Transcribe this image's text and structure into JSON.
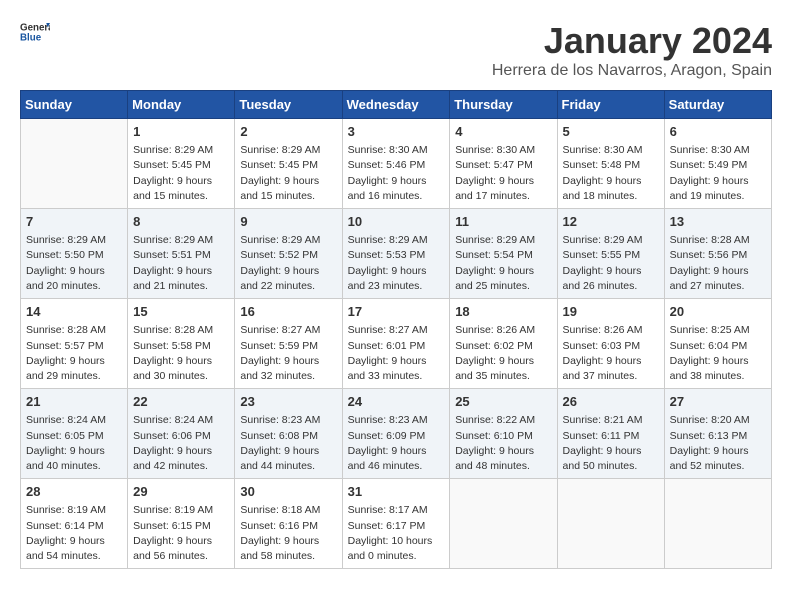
{
  "logo": {
    "general": "General",
    "blue": "Blue"
  },
  "title": "January 2024",
  "subtitle": "Herrera de los Navarros, Aragon, Spain",
  "weekdays": [
    "Sunday",
    "Monday",
    "Tuesday",
    "Wednesday",
    "Thursday",
    "Friday",
    "Saturday"
  ],
  "weeks": [
    [
      {
        "day": "",
        "info": ""
      },
      {
        "day": "1",
        "info": "Sunrise: 8:29 AM\nSunset: 5:45 PM\nDaylight: 9 hours\nand 15 minutes."
      },
      {
        "day": "2",
        "info": "Sunrise: 8:29 AM\nSunset: 5:45 PM\nDaylight: 9 hours\nand 15 minutes."
      },
      {
        "day": "3",
        "info": "Sunrise: 8:30 AM\nSunset: 5:46 PM\nDaylight: 9 hours\nand 16 minutes."
      },
      {
        "day": "4",
        "info": "Sunrise: 8:30 AM\nSunset: 5:47 PM\nDaylight: 9 hours\nand 17 minutes."
      },
      {
        "day": "5",
        "info": "Sunrise: 8:30 AM\nSunset: 5:48 PM\nDaylight: 9 hours\nand 18 minutes."
      },
      {
        "day": "6",
        "info": "Sunrise: 8:30 AM\nSunset: 5:49 PM\nDaylight: 9 hours\nand 19 minutes."
      }
    ],
    [
      {
        "day": "7",
        "info": "Sunrise: 8:29 AM\nSunset: 5:50 PM\nDaylight: 9 hours\nand 20 minutes."
      },
      {
        "day": "8",
        "info": "Sunrise: 8:29 AM\nSunset: 5:51 PM\nDaylight: 9 hours\nand 21 minutes."
      },
      {
        "day": "9",
        "info": "Sunrise: 8:29 AM\nSunset: 5:52 PM\nDaylight: 9 hours\nand 22 minutes."
      },
      {
        "day": "10",
        "info": "Sunrise: 8:29 AM\nSunset: 5:53 PM\nDaylight: 9 hours\nand 23 minutes."
      },
      {
        "day": "11",
        "info": "Sunrise: 8:29 AM\nSunset: 5:54 PM\nDaylight: 9 hours\nand 25 minutes."
      },
      {
        "day": "12",
        "info": "Sunrise: 8:29 AM\nSunset: 5:55 PM\nDaylight: 9 hours\nand 26 minutes."
      },
      {
        "day": "13",
        "info": "Sunrise: 8:28 AM\nSunset: 5:56 PM\nDaylight: 9 hours\nand 27 minutes."
      }
    ],
    [
      {
        "day": "14",
        "info": "Sunrise: 8:28 AM\nSunset: 5:57 PM\nDaylight: 9 hours\nand 29 minutes."
      },
      {
        "day": "15",
        "info": "Sunrise: 8:28 AM\nSunset: 5:58 PM\nDaylight: 9 hours\nand 30 minutes."
      },
      {
        "day": "16",
        "info": "Sunrise: 8:27 AM\nSunset: 5:59 PM\nDaylight: 9 hours\nand 32 minutes."
      },
      {
        "day": "17",
        "info": "Sunrise: 8:27 AM\nSunset: 6:01 PM\nDaylight: 9 hours\nand 33 minutes."
      },
      {
        "day": "18",
        "info": "Sunrise: 8:26 AM\nSunset: 6:02 PM\nDaylight: 9 hours\nand 35 minutes."
      },
      {
        "day": "19",
        "info": "Sunrise: 8:26 AM\nSunset: 6:03 PM\nDaylight: 9 hours\nand 37 minutes."
      },
      {
        "day": "20",
        "info": "Sunrise: 8:25 AM\nSunset: 6:04 PM\nDaylight: 9 hours\nand 38 minutes."
      }
    ],
    [
      {
        "day": "21",
        "info": "Sunrise: 8:24 AM\nSunset: 6:05 PM\nDaylight: 9 hours\nand 40 minutes."
      },
      {
        "day": "22",
        "info": "Sunrise: 8:24 AM\nSunset: 6:06 PM\nDaylight: 9 hours\nand 42 minutes."
      },
      {
        "day": "23",
        "info": "Sunrise: 8:23 AM\nSunset: 6:08 PM\nDaylight: 9 hours\nand 44 minutes."
      },
      {
        "day": "24",
        "info": "Sunrise: 8:23 AM\nSunset: 6:09 PM\nDaylight: 9 hours\nand 46 minutes."
      },
      {
        "day": "25",
        "info": "Sunrise: 8:22 AM\nSunset: 6:10 PM\nDaylight: 9 hours\nand 48 minutes."
      },
      {
        "day": "26",
        "info": "Sunrise: 8:21 AM\nSunset: 6:11 PM\nDaylight: 9 hours\nand 50 minutes."
      },
      {
        "day": "27",
        "info": "Sunrise: 8:20 AM\nSunset: 6:13 PM\nDaylight: 9 hours\nand 52 minutes."
      }
    ],
    [
      {
        "day": "28",
        "info": "Sunrise: 8:19 AM\nSunset: 6:14 PM\nDaylight: 9 hours\nand 54 minutes."
      },
      {
        "day": "29",
        "info": "Sunrise: 8:19 AM\nSunset: 6:15 PM\nDaylight: 9 hours\nand 56 minutes."
      },
      {
        "day": "30",
        "info": "Sunrise: 8:18 AM\nSunset: 6:16 PM\nDaylight: 9 hours\nand 58 minutes."
      },
      {
        "day": "31",
        "info": "Sunrise: 8:17 AM\nSunset: 6:17 PM\nDaylight: 10 hours\nand 0 minutes."
      },
      {
        "day": "",
        "info": ""
      },
      {
        "day": "",
        "info": ""
      },
      {
        "day": "",
        "info": ""
      }
    ]
  ]
}
